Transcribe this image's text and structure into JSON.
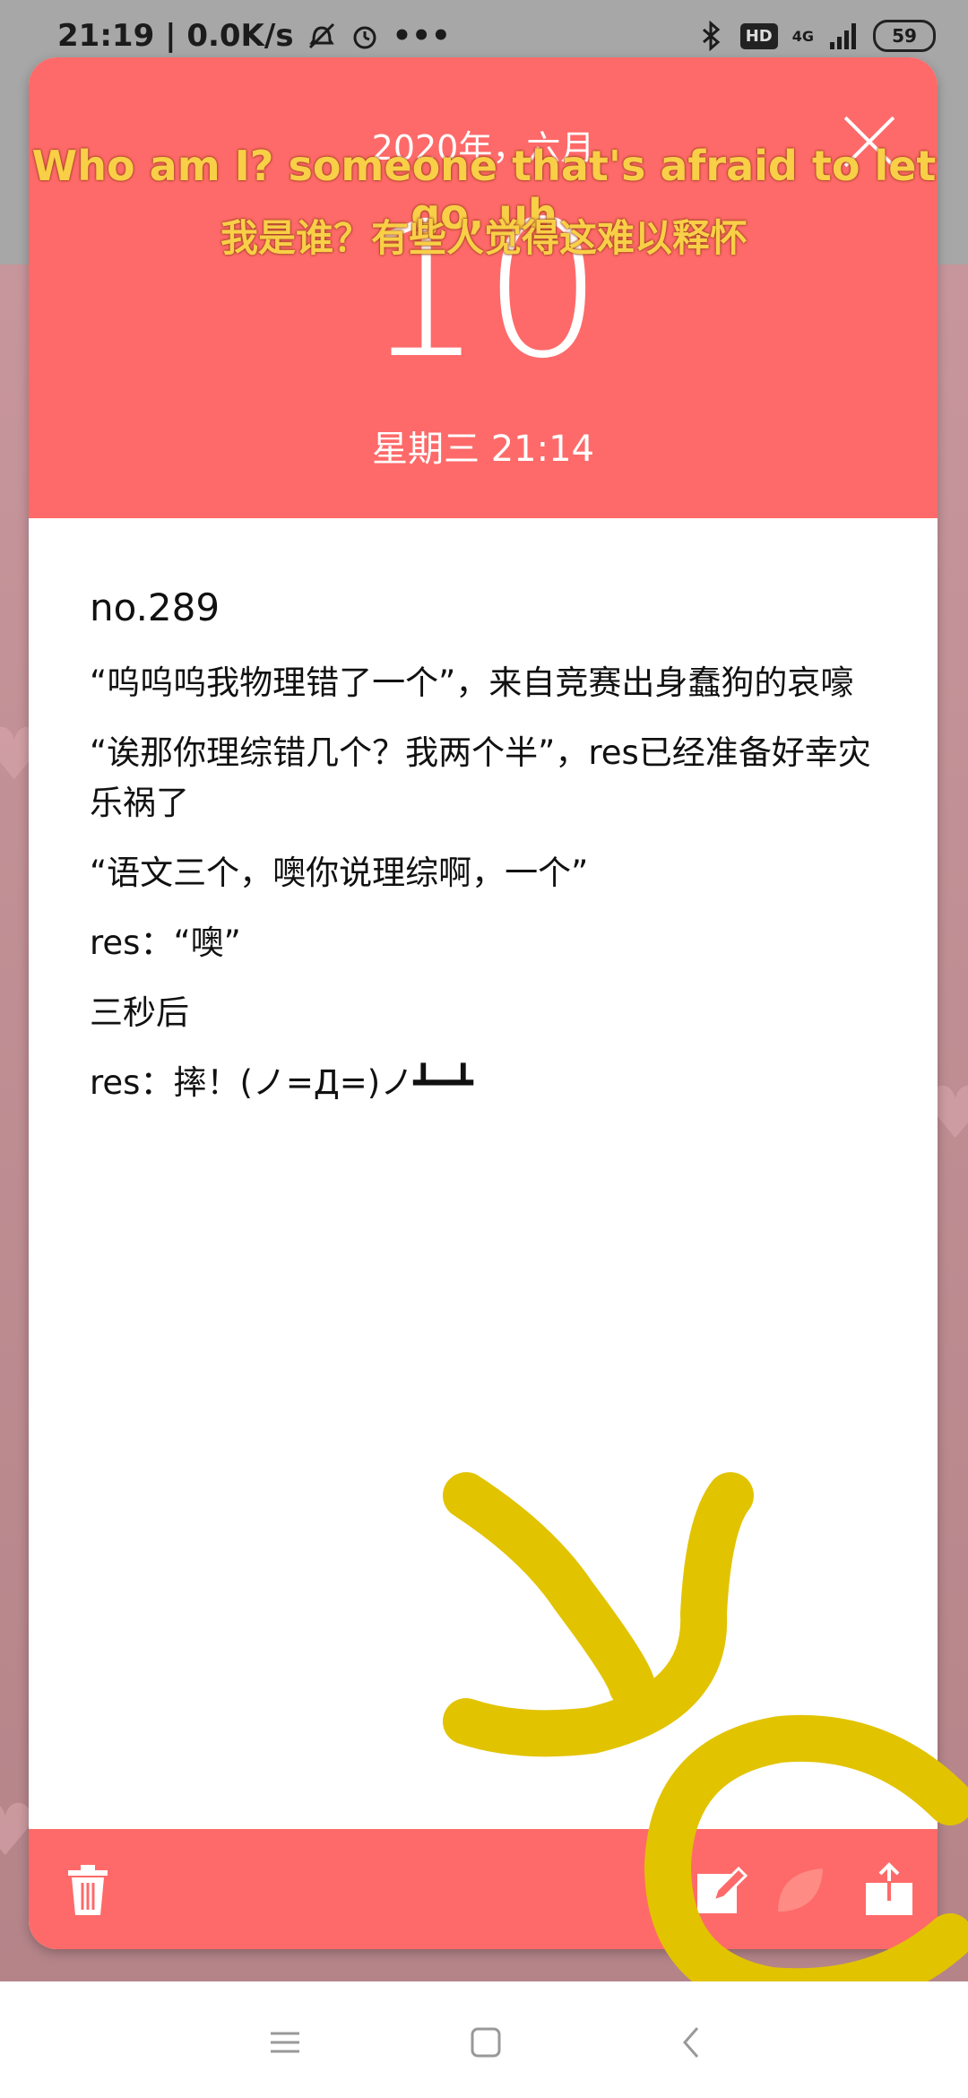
{
  "status_bar": {
    "time_speed": "21:19 | 0.0K/s",
    "more": "•••",
    "hd_label": "HD",
    "network_label": "4G",
    "battery": "59"
  },
  "header": {
    "year_month": "2020年，六月",
    "day": "10",
    "weekday_time": "星期三 21:14"
  },
  "lyrics": {
    "english": "Who am I? someone that's afraid to let go, uh",
    "chinese": "我是谁？有些人觉得这难以释怀"
  },
  "entry": {
    "number": "no.289",
    "paragraphs": [
      "“呜呜呜我物理错了一个”，来自竞赛出身蠢狗的哀嚎",
      "“诶那你理综错几个？我两个半”，res已经准备好幸灾乐祸了",
      "“语文三个，噢你说理综啊，一个”",
      "res：“噢”",
      "三秒后",
      "res：摔！(ノ=Д=)ノ┻━┻"
    ]
  },
  "icons": {
    "close": "close-icon",
    "trash": "trash-icon",
    "edit": "pencil-icon",
    "leaf": "leaf-icon",
    "share": "share-icon",
    "nav_menu": "menu-icon",
    "nav_home": "home-icon",
    "nav_back": "back-icon"
  },
  "colors": {
    "header_red": "#fe6a69",
    "lyric_yellow": "#f8cf47",
    "doodle_yellow": "#e2c300"
  }
}
